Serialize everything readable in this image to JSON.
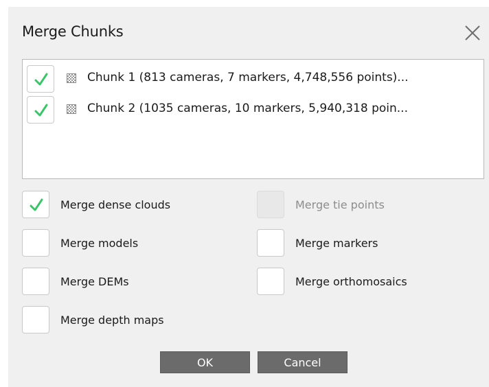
{
  "dialog": {
    "title": "Merge Chunks",
    "close_icon": "close-icon"
  },
  "colors": {
    "check": "#3cc46a",
    "button_bg": "#6b6b6b",
    "dialog_bg": "#f0f0f0"
  },
  "chunks": [
    {
      "checked": true,
      "icon": "chunk-icon",
      "label": "Chunk 1 (813 cameras, 7 markers, 4,748,556 points)..."
    },
    {
      "checked": true,
      "icon": "chunk-icon",
      "label": "Chunk 2 (1035 cameras, 10 markers, 5,940,318 poin..."
    }
  ],
  "options": {
    "merge_dense_clouds": {
      "label": "Merge dense clouds",
      "checked": true,
      "enabled": true
    },
    "merge_tie_points": {
      "label": "Merge tie points",
      "checked": false,
      "enabled": false
    },
    "merge_models": {
      "label": "Merge models",
      "checked": false,
      "enabled": true
    },
    "merge_markers": {
      "label": "Merge markers",
      "checked": false,
      "enabled": true
    },
    "merge_dems": {
      "label": "Merge DEMs",
      "checked": false,
      "enabled": true
    },
    "merge_orthomosaics": {
      "label": "Merge orthomosaics",
      "checked": false,
      "enabled": true
    },
    "merge_depth_maps": {
      "label": "Merge depth maps",
      "checked": false,
      "enabled": true
    }
  },
  "buttons": {
    "ok": "OK",
    "cancel": "Cancel"
  }
}
